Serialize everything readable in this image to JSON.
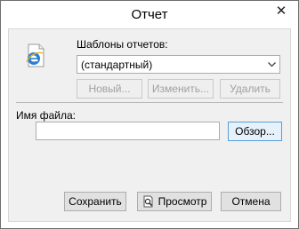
{
  "window": {
    "title": "Отчет",
    "close_glyph": "✕"
  },
  "templates": {
    "label": "Шаблоны отчетов:",
    "selected": "(стандартный)",
    "icon": "document-ie-icon"
  },
  "template_buttons": {
    "new": "Новый...",
    "edit": "Изменить...",
    "delete": "Удалить"
  },
  "file": {
    "label": "Имя файла:",
    "value": "",
    "browse": "Обзор..."
  },
  "actions": {
    "save": "Сохранить",
    "preview": "Просмотр",
    "preview_icon": "magnifier-document-icon",
    "cancel": "Отмена"
  },
  "colors": {
    "dialog_bg": "#f0f0f0",
    "button_bg": "#e1e1e1",
    "focus_border": "#5a9ed8",
    "disabled_text": "#a0a0a0"
  }
}
